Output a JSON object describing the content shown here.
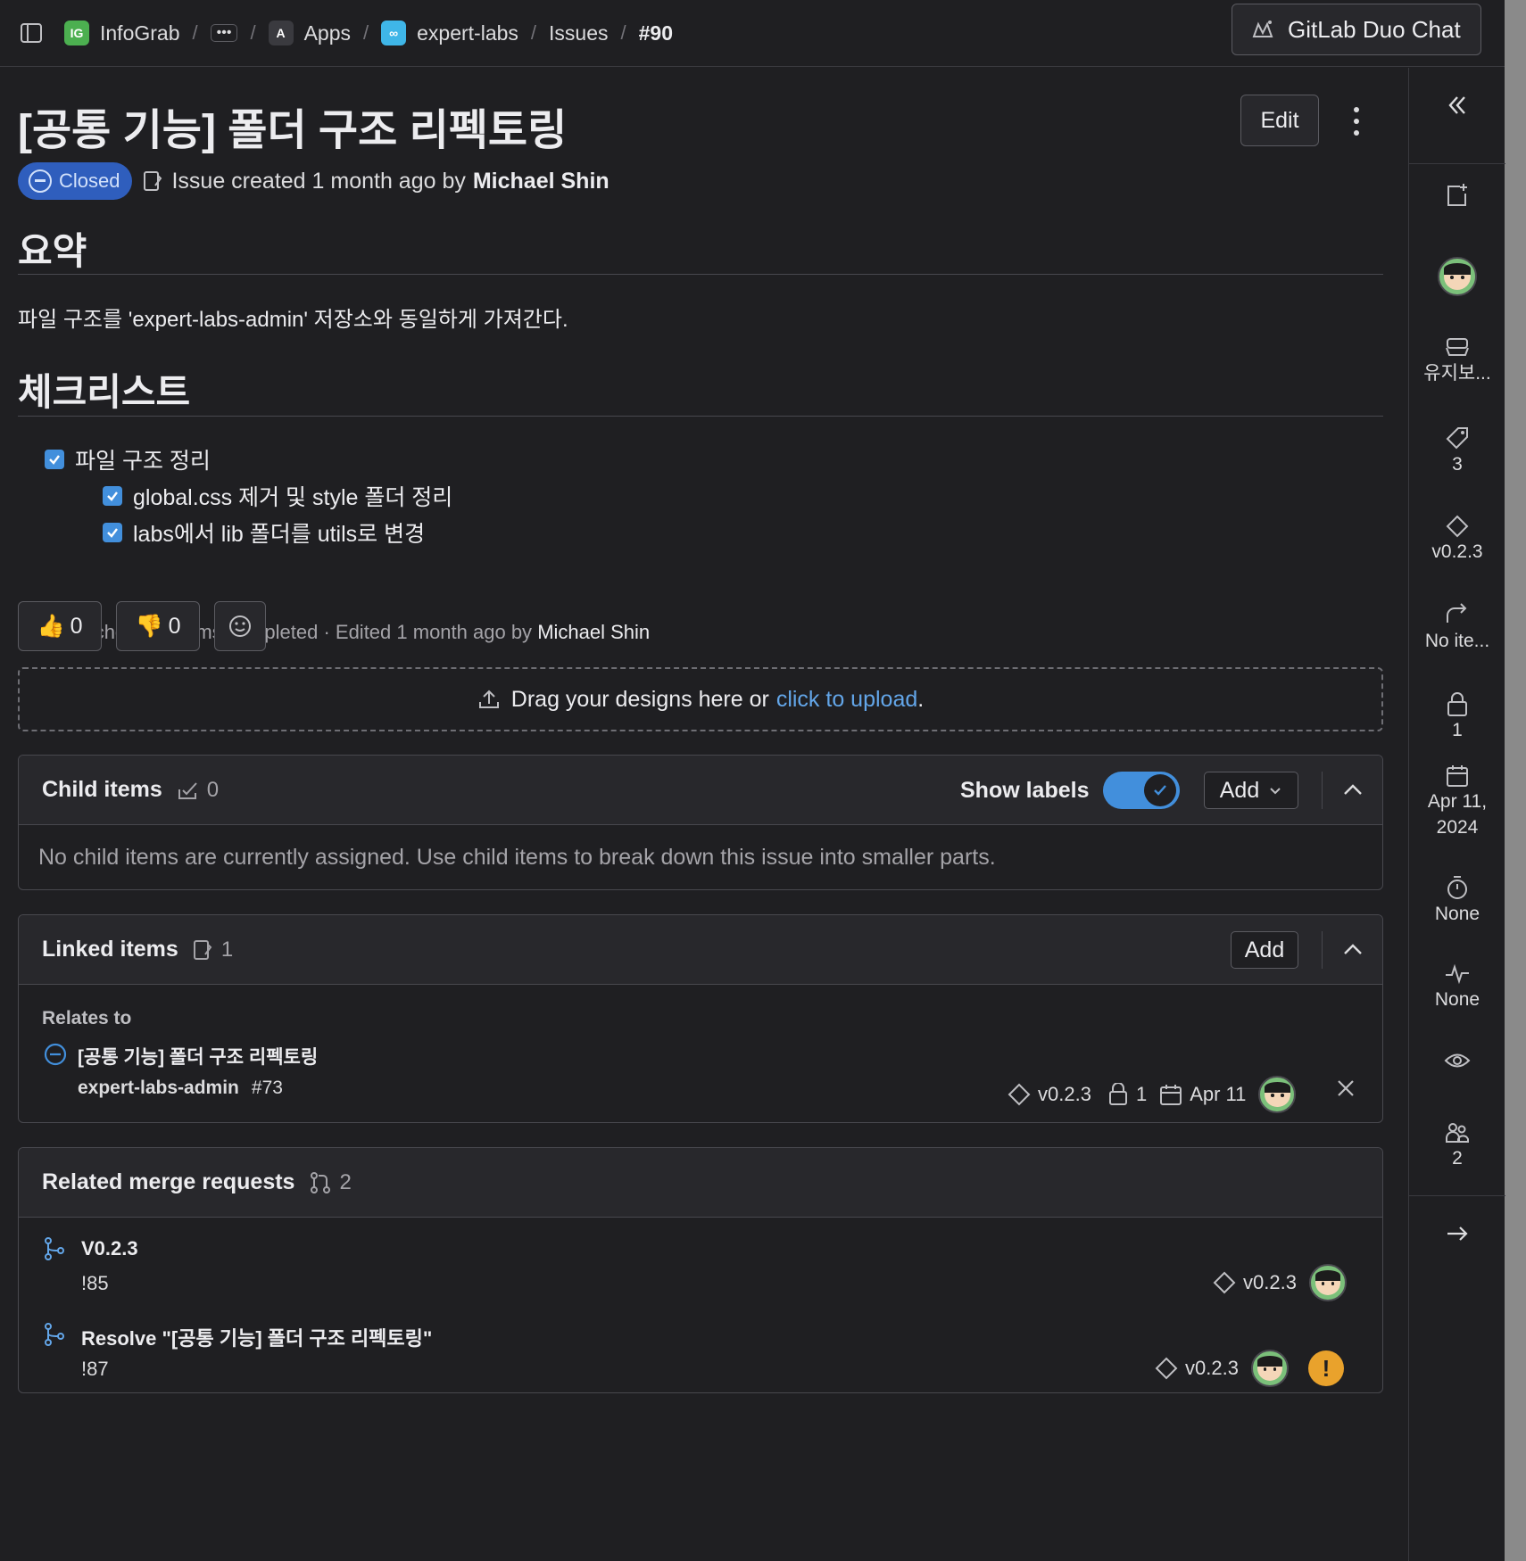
{
  "breadcrumb": {
    "org": "InfoGrab",
    "more": "•••",
    "group": "Apps",
    "project": "expert-labs",
    "section": "Issues",
    "current": "#90"
  },
  "duo_chat": {
    "label": "GitLab Duo Chat"
  },
  "issue": {
    "title": "[공통 기능] 폴더 구조 리펙토링",
    "edit_label": "Edit",
    "status": "Closed",
    "created_prefix": "Issue created 1 month ago by",
    "author": "Michael Shin"
  },
  "description": {
    "summary_heading": "요약",
    "summary_text": "파일 구조를 'expert-labs-admin' 저장소와 동일하게 가져간다.",
    "checklist_heading": "체크리스트",
    "checklist": [
      {
        "label": "파일 구조 정리",
        "checked": true,
        "level": 0
      },
      {
        "label": "global.css 제거 및 style 폴더 정리",
        "checked": true,
        "level": 1
      },
      {
        "label": "labs에서 lib 폴더를 utils로 변경",
        "checked": true,
        "level": 1
      }
    ],
    "status_text": "✓ 3 of 3 checklist items completed · Edited 1 month ago by",
    "status_author": "Michael Shin"
  },
  "reactions": {
    "thumbs_up": "0",
    "thumbs_down": "0"
  },
  "designs": {
    "text": "Drag your designs here or",
    "link": "click to upload",
    "suffix": "."
  },
  "child_items": {
    "title": "Child items",
    "count": "0",
    "show_labels": "Show labels",
    "add": "Add",
    "empty": "No child items are currently assigned. Use child items to break down this issue into smaller parts."
  },
  "linked_items": {
    "title": "Linked items",
    "count": "1",
    "add": "Add",
    "group_label": "Relates to",
    "item": {
      "title": "[공통 기능] 폴더 구조 리펙토링",
      "project": "expert-labs-admin",
      "ref": "#73",
      "milestone": "v0.2.3",
      "weight": "1",
      "due": "Apr 11"
    }
  },
  "merge_requests": {
    "title": "Related merge requests",
    "count": "2",
    "items": [
      {
        "title": "V0.2.3",
        "ref": "!85",
        "milestone": "v0.2.3"
      },
      {
        "title": "Resolve \"[공통 기능] 폴더 구조 리펙토링\"",
        "ref": "!87",
        "milestone": "v0.2.3"
      }
    ]
  },
  "sidebar": {
    "milestone_label": "유지보...",
    "labels_count": "3",
    "milestone": "v0.2.3",
    "iteration": "No ite...",
    "weight": "1",
    "due_date": "Apr 11, 2024",
    "time_tracking": "None",
    "health": "None",
    "participants": "2"
  },
  "colors": {
    "accent": "#428fdc",
    "closed_badge": "#2f5ebd",
    "warning": "#e9a22c"
  }
}
